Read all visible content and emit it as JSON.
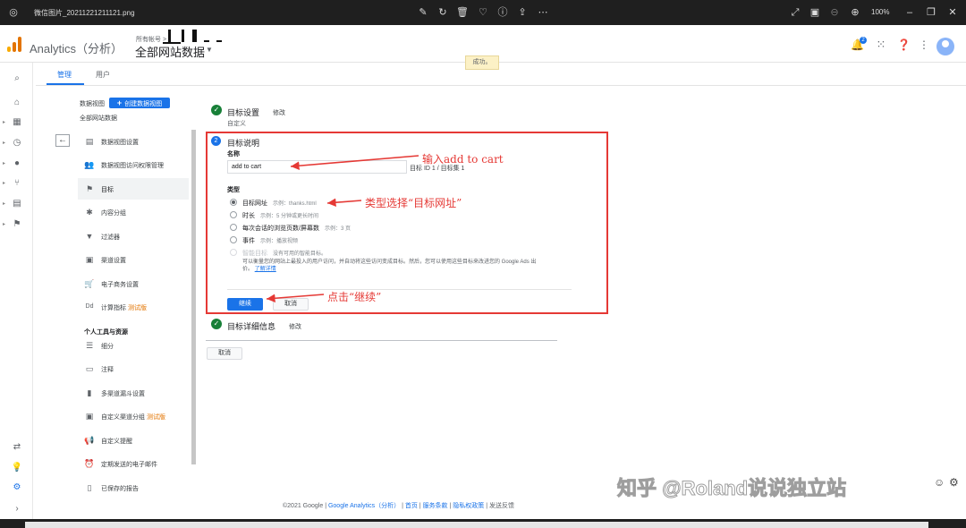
{
  "viewer": {
    "filename": "微信图片_20211221211121.png",
    "zoom": "100%"
  },
  "header": {
    "app_title": "Analytics（分析）",
    "account_label": "所有帐号 > ",
    "account_name": "全部网站数据",
    "notification_count": "2",
    "toast": "成功。"
  },
  "tabs": {
    "admin": "管理",
    "user": "用户"
  },
  "sidebar": {
    "view_label": "数据视图",
    "create_view_button": "创建数据视图",
    "view_name": "全部网站数据",
    "items": [
      {
        "label": "数据视图设置",
        "icon": "document-icon"
      },
      {
        "label": "数据视图访问权限管理",
        "icon": "people-icon"
      },
      {
        "label": "目标",
        "icon": "flag-icon"
      },
      {
        "label": "内容分组",
        "icon": "person-walk-icon"
      },
      {
        "label": "过滤器",
        "icon": "filter-icon"
      },
      {
        "label": "渠道设置",
        "icon": "channel-icon"
      },
      {
        "label": "电子商务设置",
        "icon": "cart-icon"
      },
      {
        "label": "计算指标",
        "icon": "dd-icon",
        "beta": "测试版"
      }
    ],
    "section_title": "个人工具与资源",
    "tool_items": [
      {
        "label": "细分",
        "icon": "segment-icon"
      },
      {
        "label": "注释",
        "icon": "annotation-icon"
      },
      {
        "label": "多渠道漏斗设置",
        "icon": "bar-chart-icon"
      },
      {
        "label": "自定义渠道分组",
        "icon": "channel-group-icon",
        "beta": "测试版"
      },
      {
        "label": "自定义提醒",
        "icon": "megaphone-icon"
      },
      {
        "label": "定期发送的电子邮件",
        "icon": "clock-icon"
      },
      {
        "label": "已保存的报告",
        "icon": "report-icon"
      }
    ]
  },
  "form": {
    "step1": {
      "title": "目标设置",
      "edit": "修改",
      "sub": "自定义"
    },
    "step2": {
      "number": "2",
      "title": "目标说明",
      "name_label": "名称",
      "name_value": "add to cart",
      "goal_id": "目标 ID 1 / 目标集 1",
      "type_label": "类型",
      "types": [
        {
          "label": "目标网址",
          "example": "示例：thanks.html",
          "checked": true
        },
        {
          "label": "时长",
          "example": "示例：5 分钟或更长时间",
          "checked": false
        },
        {
          "label": "每次会话的浏览页数/屏幕数",
          "example": "示例：3 页",
          "checked": false
        },
        {
          "label": "事件",
          "example": "示例：播放视频",
          "checked": false
        },
        {
          "label": "智能目标",
          "example": "没有可用的智能目标。",
          "checked": false,
          "disabled": true
        }
      ],
      "smart_desc": "可以衡量您的网站上最投入的用户访问，并自动将这些访问变成目标。然后，您可以使用这些目标来改进您的 Google Ads 出价。",
      "learn_more": "了解详情",
      "continue_button": "继续",
      "cancel_button": "取消"
    },
    "step3": {
      "title": "目标详细信息",
      "edit": "修改"
    },
    "bottom_cancel": "取消"
  },
  "annotations": {
    "name_hint": "输入add to cart",
    "type_hint": "类型选择“目标网址”",
    "continue_hint": "点击“继续”",
    "accent_color": "#e53935"
  },
  "footer": {
    "copyright": "©2021 Google | ",
    "ga_link": "Google Analytics（分析）",
    "home": "首页",
    "sep": " | ",
    "terms": "服务条款",
    "privacy": "隐私权政策",
    "feedback": "发送反馈"
  },
  "watermark": "知乎 @Roland说说独立站"
}
